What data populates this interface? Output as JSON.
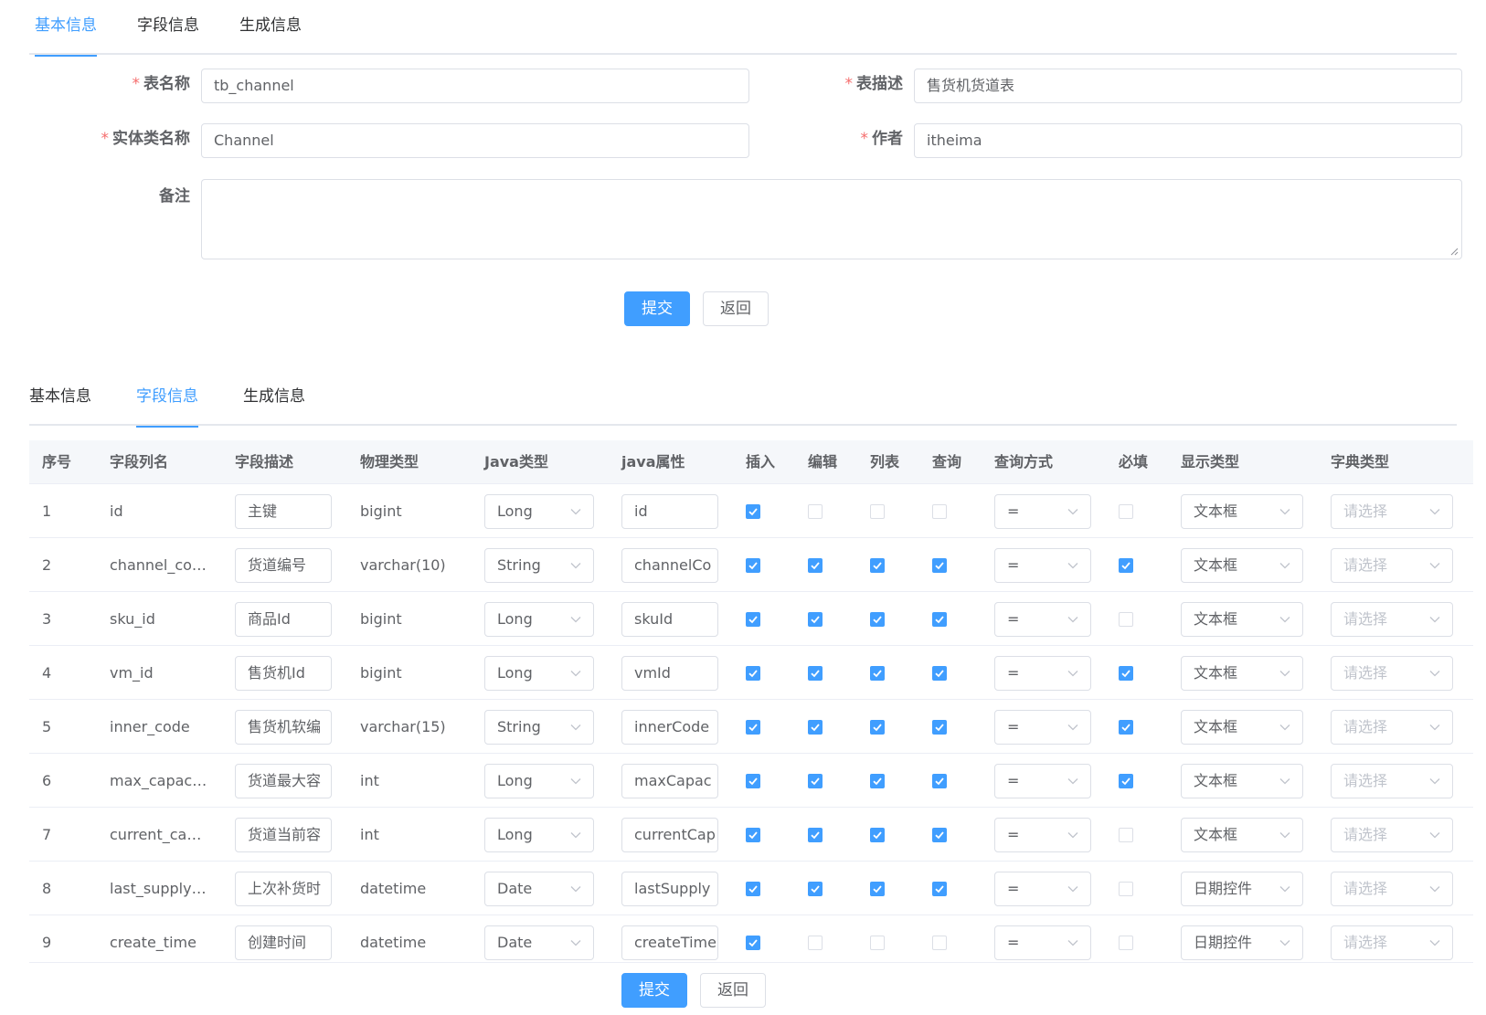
{
  "top_tabs": [
    "基本信息",
    "字段信息",
    "生成信息"
  ],
  "basic_form": {
    "table_name_label": "表名称",
    "table_name": "tb_channel",
    "table_desc_label": "表描述",
    "table_desc": "售货机货道表",
    "entity_name_label": "实体类名称",
    "entity_name": "Channel",
    "author_label": "作者",
    "author": "itheima",
    "remark_label": "备注",
    "remark": "",
    "required_mark": "*"
  },
  "buttons": {
    "submit": "提交",
    "back": "返回"
  },
  "field_tabs": [
    "基本信息",
    "字段信息",
    "生成信息"
  ],
  "columns": [
    "序号",
    "字段列名",
    "字段描述",
    "物理类型",
    "Java类型",
    "java属性",
    "插入",
    "编辑",
    "列表",
    "查询",
    "查询方式",
    "必填",
    "显示类型",
    "字典类型"
  ],
  "rows": [
    {
      "seq": "1",
      "column": "id",
      "desc": "主键",
      "phys": "bigint",
      "java_type": "Long",
      "java_field": "id",
      "insert": true,
      "edit": false,
      "list": false,
      "query": false,
      "query_type": "=",
      "required": false,
      "html_type": "文本框",
      "dict": "请选择"
    },
    {
      "seq": "2",
      "column": "channel_co…",
      "desc": "货道编号",
      "phys": "varchar(10)",
      "java_type": "String",
      "java_field": "channelCo",
      "insert": true,
      "edit": true,
      "list": true,
      "query": true,
      "query_type": "=",
      "required": true,
      "html_type": "文本框",
      "dict": "请选择"
    },
    {
      "seq": "3",
      "column": "sku_id",
      "desc": "商品Id",
      "phys": "bigint",
      "java_type": "Long",
      "java_field": "skuId",
      "insert": true,
      "edit": true,
      "list": true,
      "query": true,
      "query_type": "=",
      "required": false,
      "html_type": "文本框",
      "dict": "请选择"
    },
    {
      "seq": "4",
      "column": "vm_id",
      "desc": "售货机Id",
      "phys": "bigint",
      "java_type": "Long",
      "java_field": "vmId",
      "insert": true,
      "edit": true,
      "list": true,
      "query": true,
      "query_type": "=",
      "required": true,
      "html_type": "文本框",
      "dict": "请选择"
    },
    {
      "seq": "5",
      "column": "inner_code",
      "desc": "售货机软编",
      "phys": "varchar(15)",
      "java_type": "String",
      "java_field": "innerCode",
      "insert": true,
      "edit": true,
      "list": true,
      "query": true,
      "query_type": "=",
      "required": true,
      "html_type": "文本框",
      "dict": "请选择"
    },
    {
      "seq": "6",
      "column": "max_capacity",
      "desc": "货道最大容",
      "phys": "int",
      "java_type": "Long",
      "java_field": "maxCapac",
      "insert": true,
      "edit": true,
      "list": true,
      "query": true,
      "query_type": "=",
      "required": true,
      "html_type": "文本框",
      "dict": "请选择"
    },
    {
      "seq": "7",
      "column": "current_ca…",
      "desc": "货道当前容",
      "phys": "int",
      "java_type": "Long",
      "java_field": "currentCap",
      "insert": true,
      "edit": true,
      "list": true,
      "query": true,
      "query_type": "=",
      "required": false,
      "html_type": "文本框",
      "dict": "请选择"
    },
    {
      "seq": "8",
      "column": "last_supply…",
      "desc": "上次补货时",
      "phys": "datetime",
      "java_type": "Date",
      "java_field": "lastSupply",
      "insert": true,
      "edit": true,
      "list": true,
      "query": true,
      "query_type": "=",
      "required": false,
      "html_type": "日期控件",
      "dict": "请选择"
    },
    {
      "seq": "9",
      "column": "create_time",
      "desc": "创建时间",
      "phys": "datetime",
      "java_type": "Date",
      "java_field": "createTime",
      "insert": true,
      "edit": false,
      "list": false,
      "query": false,
      "query_type": "=",
      "required": false,
      "html_type": "日期控件",
      "dict": "请选择"
    }
  ],
  "colors": {
    "primary": "#409eff",
    "required_star": "#f56c6c",
    "border": "#dcdfe6",
    "header_bg": "#f5f7fa",
    "placeholder": "#c0c4cc"
  }
}
